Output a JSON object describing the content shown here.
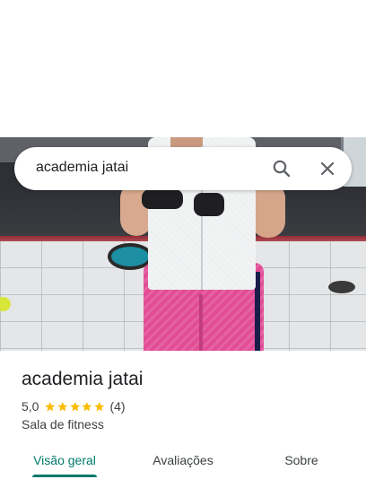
{
  "search": {
    "query": "academia jatai"
  },
  "place": {
    "name": "academia jatai",
    "rating": "5,0",
    "stars": 5,
    "review_count": "(4)",
    "category": "Sala de fitness"
  },
  "tabs": [
    {
      "label": "Visão geral",
      "active": true
    },
    {
      "label": "Avaliações",
      "active": false
    },
    {
      "label": "Sobre",
      "active": false
    }
  ],
  "icons": {
    "search": "search-icon",
    "close": "close-icon",
    "star": "star-icon"
  },
  "colors": {
    "accent": "#00796b",
    "star": "#fbbc04",
    "text_primary": "#202124",
    "text_secondary": "#3c4043"
  }
}
